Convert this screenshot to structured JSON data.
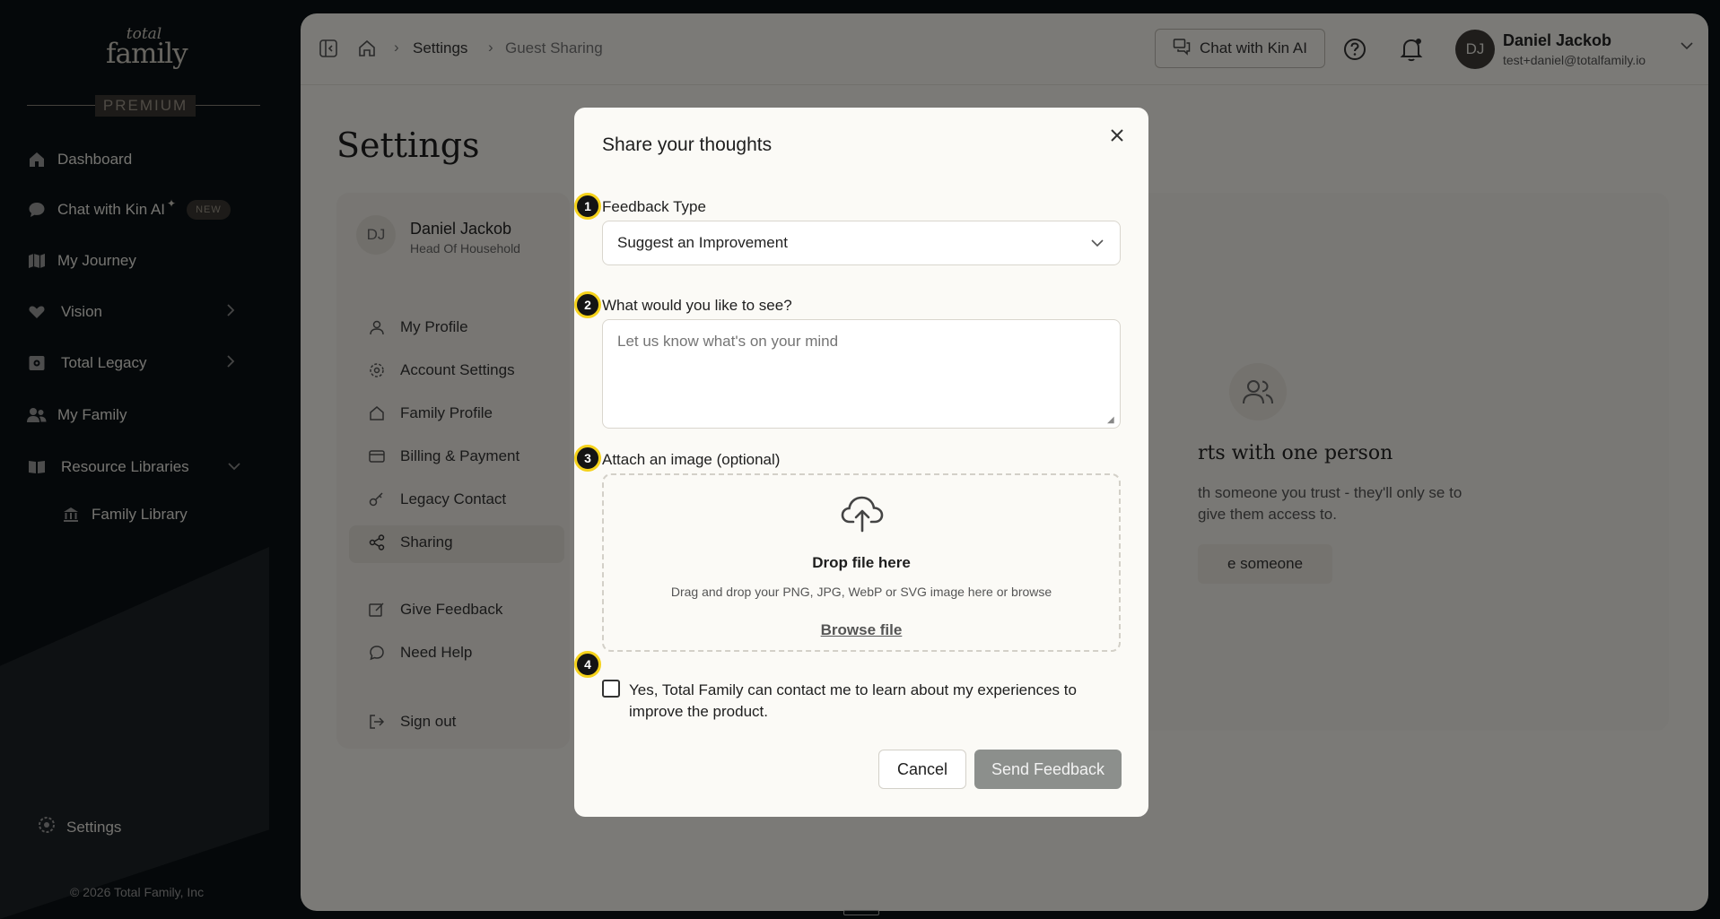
{
  "sidebar": {
    "logo_line1": "total",
    "logo_line2": "family",
    "badge": "PREMIUM",
    "nav": [
      {
        "label": "Dashboard"
      },
      {
        "label": "Chat with Kin AI",
        "badge": "NEW"
      },
      {
        "label": "My Journey"
      },
      {
        "label": "Vision"
      },
      {
        "label": "Total Legacy"
      },
      {
        "label": "My Family"
      },
      {
        "label": "Resource Libraries"
      },
      {
        "label": "Family Library"
      }
    ],
    "settings_label": "Settings",
    "copyright": "© 2026 Total Family, Inc"
  },
  "topbar": {
    "breadcrumb": [
      "Settings",
      "Guest Sharing"
    ],
    "kin_button": "Chat with Kin AI",
    "user_initials": "DJ",
    "user_name": "Daniel Jackob",
    "user_email": "test+daniel@totalfamily.io"
  },
  "settings": {
    "title": "Settings",
    "profile_initials": "DJ",
    "profile_name": "Daniel Jackob",
    "profile_role": "Head Of Household",
    "menu": [
      {
        "label": "My Profile",
        "icon": "user-icon"
      },
      {
        "label": "Account Settings",
        "icon": "gear-icon"
      },
      {
        "label": "Family Profile",
        "icon": "home-icon"
      },
      {
        "label": "Billing & Payment",
        "icon": "card-icon"
      },
      {
        "label": "Legacy Contact",
        "icon": "key-icon"
      },
      {
        "label": "Sharing",
        "icon": "share-icon",
        "active": true
      },
      {
        "label": "Give Feedback",
        "icon": "edit-icon"
      },
      {
        "label": "Need Help",
        "icon": "chat-icon"
      },
      {
        "label": "Sign out",
        "icon": "logout-icon"
      }
    ]
  },
  "empty_state": {
    "title": "rts with one person",
    "desc": "th someone you trust - they'll only se to give them access to.",
    "button": "e someone"
  },
  "modal": {
    "title": "Share your thoughts",
    "steps": [
      "1",
      "2",
      "3",
      "4"
    ],
    "feedback_type_label": "Feedback Type",
    "feedback_type_value": "Suggest an Improvement",
    "message_label": "What would you like to see?",
    "message_placeholder": "Let us know what's on your mind",
    "attach_label": "Attach an image (optional)",
    "drop_title": "Drop file here",
    "drop_desc": "Drag and drop your PNG, JPG, WebP or SVG image here or browse",
    "browse": "Browse file",
    "consent": "Yes, Total Family can contact me to learn about my experiences to improve the product.",
    "cancel": "Cancel",
    "send": "Send Feedback"
  },
  "colors": {
    "step_ring": "#f5d21b",
    "send_button": "#8c8f8c",
    "sidebar_bg": "#0b1114",
    "panel_bg": "#f6f4ef"
  }
}
